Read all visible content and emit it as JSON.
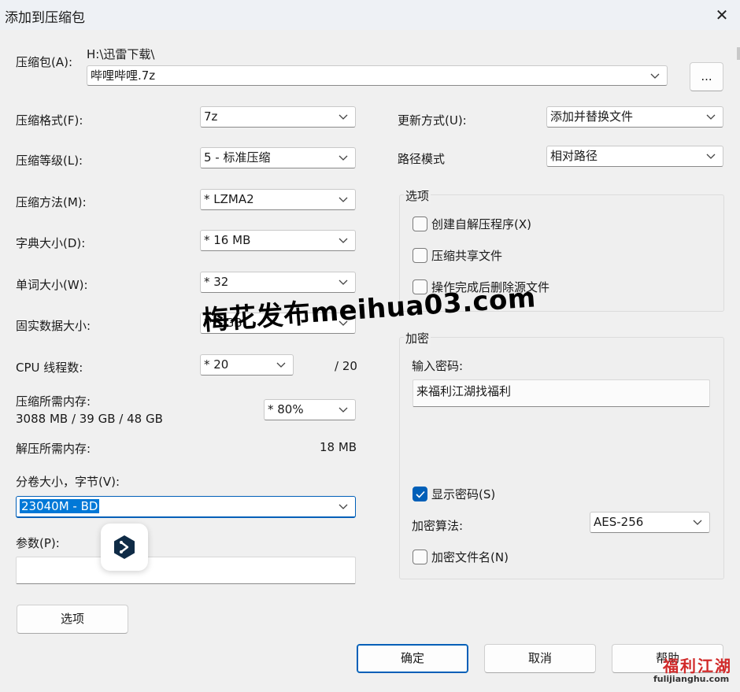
{
  "window": {
    "title": "添加到压缩包",
    "close_glyph": "✕"
  },
  "archive": {
    "label": "压缩包(A):",
    "path": "H:\\迅雷下载\\",
    "filename": "哔哩哔哩.7z",
    "browse_label": "..."
  },
  "left": {
    "format": {
      "label": "压缩格式(F):",
      "value": "7z"
    },
    "level": {
      "label": "压缩等级(L):",
      "value": "5 - 标准压缩"
    },
    "method": {
      "label": "压缩方法(M):",
      "value": "*  LZMA2"
    },
    "dict": {
      "label": "字典大小(D):",
      "value": "*  16 MB"
    },
    "word": {
      "label": "单词大小(W):",
      "value": "*  32"
    },
    "solid": {
      "label": "固实数据大小:",
      "value": "*  8 GB"
    },
    "cpu": {
      "label": "CPU 线程数:",
      "value": "*  20",
      "total": "/ 20"
    },
    "mem_compress": {
      "label": "压缩所需内存:",
      "detail": "3088 MB / 39 GB / 48 GB",
      "value": "*  80%"
    },
    "mem_decompress": {
      "label": "解压所需内存:",
      "value": "18 MB"
    },
    "volume": {
      "label": "分卷大小，字节(V):",
      "value": "23040M - BD"
    },
    "params": {
      "label": "参数(P):",
      "value": ""
    }
  },
  "right": {
    "update": {
      "label": "更新方式(U):",
      "value": "添加并替换文件"
    },
    "path_mode": {
      "label": "路径模式",
      "value": "相对路径"
    },
    "options": {
      "title": "选项",
      "sfx": {
        "label": "创建自解压程序(X)",
        "checked": false
      },
      "shared": {
        "label": "压缩共享文件",
        "checked": false
      },
      "delete": {
        "label": "操作完成后删除源文件",
        "checked": false
      }
    },
    "encryption": {
      "title": "加密",
      "password_label": "输入密码:",
      "password_value": "来福利江湖找福利",
      "show_password": {
        "label": "显示密码(S)",
        "checked": true
      },
      "method_label": "加密算法:",
      "method_value": "AES-256",
      "encrypt_names": {
        "label": "加密文件名(N)",
        "checked": false
      }
    }
  },
  "buttons": {
    "options": "选项",
    "ok": "确定",
    "cancel": "取消",
    "help": "帮助"
  },
  "overlays": {
    "watermark": "梅花发布meihua03.com",
    "corner_brand": "福利江湖",
    "corner_url": "fulijianghu.com"
  },
  "colors": {
    "accent": "#005fb8",
    "selection": "#0078d7",
    "watermark": "#000000",
    "brand_red": "#d12a2a"
  }
}
